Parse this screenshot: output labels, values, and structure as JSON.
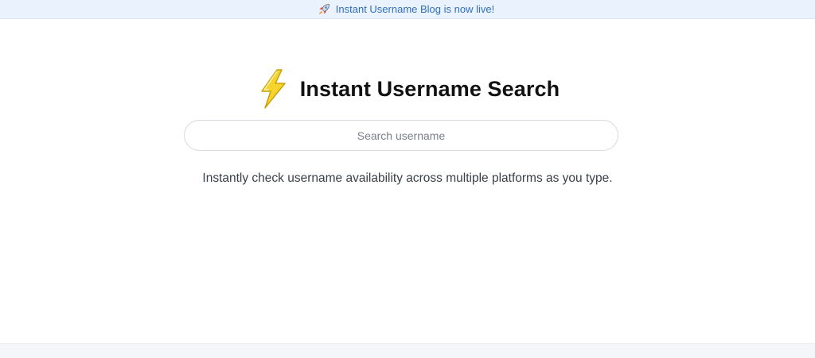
{
  "banner": {
    "text": "Instant Username Blog is now live!",
    "icon": "rocket-icon",
    "link_color": "#2f6fbd",
    "background": "#eaf3fd"
  },
  "header": {
    "title": "Instant Username Search",
    "icon": "lightning-bolt-icon",
    "icon_color": "#f6d32d"
  },
  "search": {
    "placeholder": "Search username",
    "value": ""
  },
  "tagline": "Instantly check username availability across multiple platforms as you type."
}
